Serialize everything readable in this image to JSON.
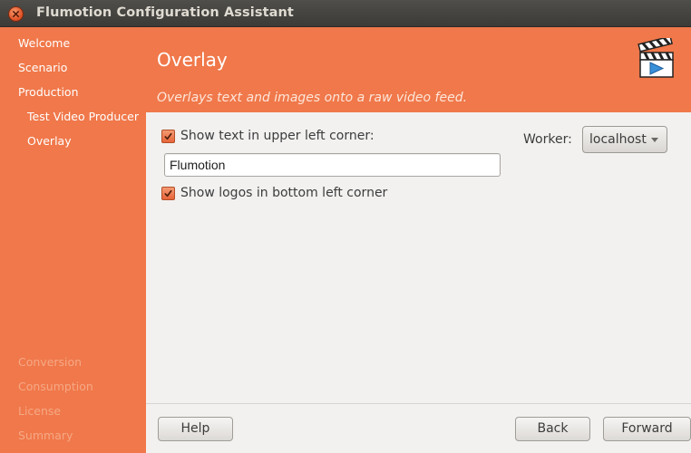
{
  "window": {
    "title": "Flumotion Configuration Assistant"
  },
  "sidebar": {
    "items": [
      {
        "label": "Welcome",
        "state": "done"
      },
      {
        "label": "Scenario",
        "state": "done"
      },
      {
        "label": "Production",
        "state": "done"
      },
      {
        "label": "Test Video Producer",
        "state": "done"
      },
      {
        "label": "Overlay",
        "state": "current"
      },
      {
        "label": "Conversion",
        "state": "disabled"
      },
      {
        "label": "Consumption",
        "state": "disabled"
      },
      {
        "label": "License",
        "state": "disabled"
      },
      {
        "label": "Summary",
        "state": "disabled"
      }
    ]
  },
  "header": {
    "title": "Overlay",
    "subtitle": "Overlays text and images onto a raw video feed.",
    "icon": "clapperboard-icon"
  },
  "form": {
    "show_text_label": "Show text in upper left corner:",
    "show_text_checked": true,
    "text_value": "Flumotion",
    "show_logos_label": "Show logos in bottom left corner",
    "show_logos_checked": true,
    "worker_label": "Worker:",
    "worker_value": "localhost"
  },
  "footer": {
    "help_label": "Help",
    "back_label": "Back",
    "forward_label": "Forward"
  },
  "colors": {
    "accent": "#f0784a",
    "window_bg": "#f2f1f0",
    "titlebar": "#3c3b37"
  }
}
